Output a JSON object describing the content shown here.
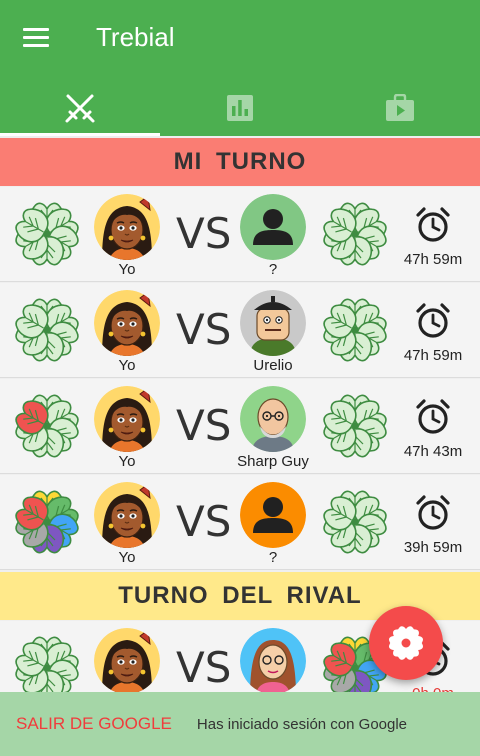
{
  "app_bar": {
    "title": "Trebial",
    "tabs": [
      {
        "icon": "crossed-swords-icon",
        "active": true
      },
      {
        "icon": "bar-chart-icon",
        "active": false
      },
      {
        "icon": "briefcase-icon",
        "active": false
      }
    ]
  },
  "sections": {
    "my_turn": "MI  TURNO",
    "rival_turn": "TURNO  DEL  RIVAL"
  },
  "versus": "VS",
  "games": [
    {
      "player": "Yo",
      "opponent": "?",
      "time_left": "47h 59m",
      "player_progress": "none",
      "opponent_progress": "none"
    },
    {
      "player": "Yo",
      "opponent": "Urelio",
      "time_left": "47h 59m",
      "player_progress": "none",
      "opponent_progress": "none"
    },
    {
      "player": "Yo",
      "opponent": "Sharp Guy",
      "time_left": "47h 43m",
      "player_progress": "1 red petal",
      "opponent_progress": "none"
    },
    {
      "player": "Yo",
      "opponent": "?",
      "time_left": "39h 59m",
      "player_progress": "red, yellow, green, blue, purple, grey petals",
      "opponent_progress": "none"
    }
  ],
  "rival_games": [
    {
      "player": "Yo",
      "opponent": "",
      "time_left": "0h 0m"
    }
  ],
  "colors": {
    "primary": "#4caf50",
    "my_turn_header": "#fa7d73",
    "rival_turn_header": "#ffe98a",
    "fab": "#f44b4b",
    "snackbar": "#a5d6a7",
    "snackbar_action": "#f03c3c"
  },
  "snackbar": {
    "action": "SALIR DE GOOGLE",
    "message": "Has iniciado sesión con Google"
  }
}
